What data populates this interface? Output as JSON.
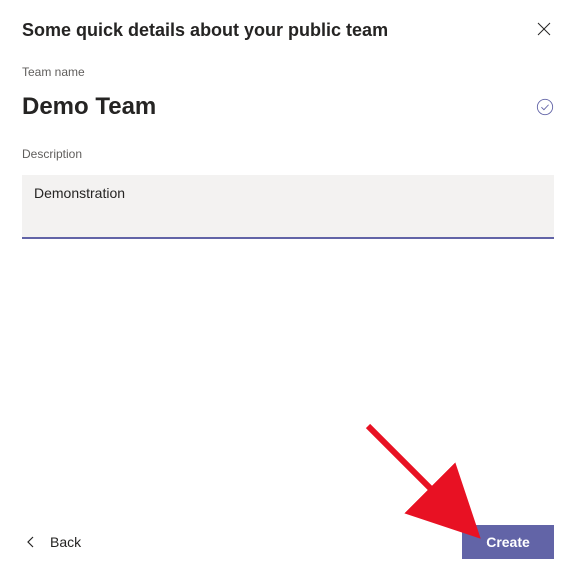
{
  "dialog": {
    "title": "Some quick details about your public team",
    "close_icon": "close"
  },
  "fields": {
    "team_name": {
      "label": "Team name",
      "value": "Demo Team",
      "validated": true
    },
    "description": {
      "label": "Description",
      "value": "Demonstration"
    }
  },
  "footer": {
    "back_label": "Back",
    "create_label": "Create"
  },
  "colors": {
    "accent": "#6264a7"
  }
}
